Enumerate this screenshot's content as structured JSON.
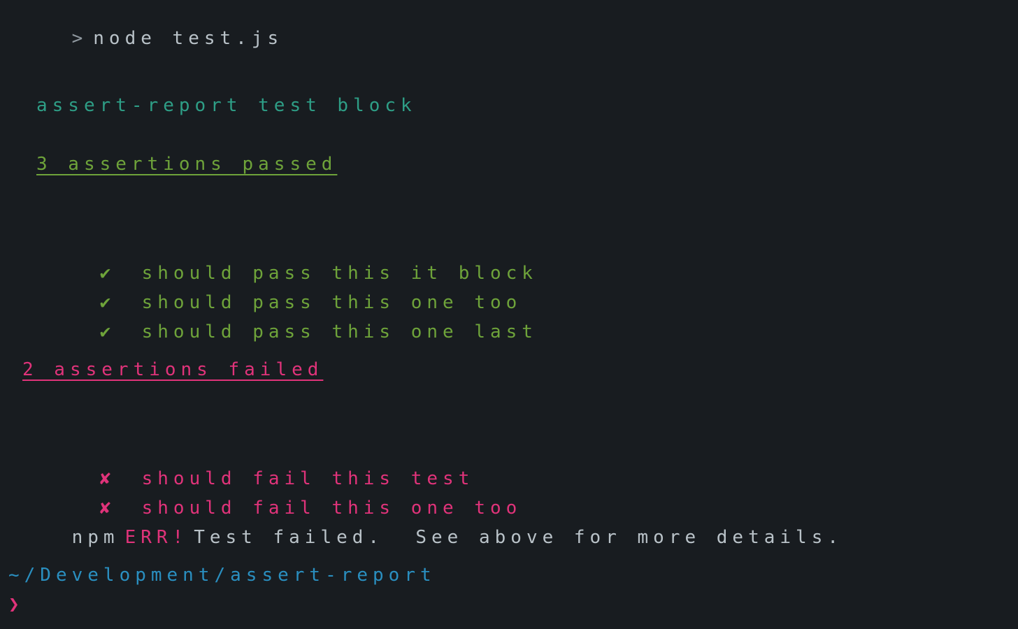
{
  "command": {
    "prompt_symbol": ">",
    "text": "node test.js"
  },
  "suite": {
    "title": "assert-report test block"
  },
  "passed": {
    "summary": "3 assertions passed",
    "check_symbol": "✔",
    "items": [
      "should pass this it block",
      "should pass this one too",
      "should pass this one last"
    ]
  },
  "failed": {
    "summary": "2 assertions failed",
    "cross_symbol": "✘",
    "items": [
      "should fail this test",
      "should fail this one too"
    ]
  },
  "npm_error": {
    "prefix": "npm",
    "tag": "ERR!",
    "message": "Test failed.  See above for more details."
  },
  "cwd": "~/Development/assert-report",
  "next_prompt_symbol": "❯",
  "colors": {
    "background": "#181c20",
    "default_text": "#b9c2c8",
    "suite_title": "#2e9e86",
    "pass": "#6ea33a",
    "fail": "#e0337a",
    "path": "#2a8fc0"
  }
}
